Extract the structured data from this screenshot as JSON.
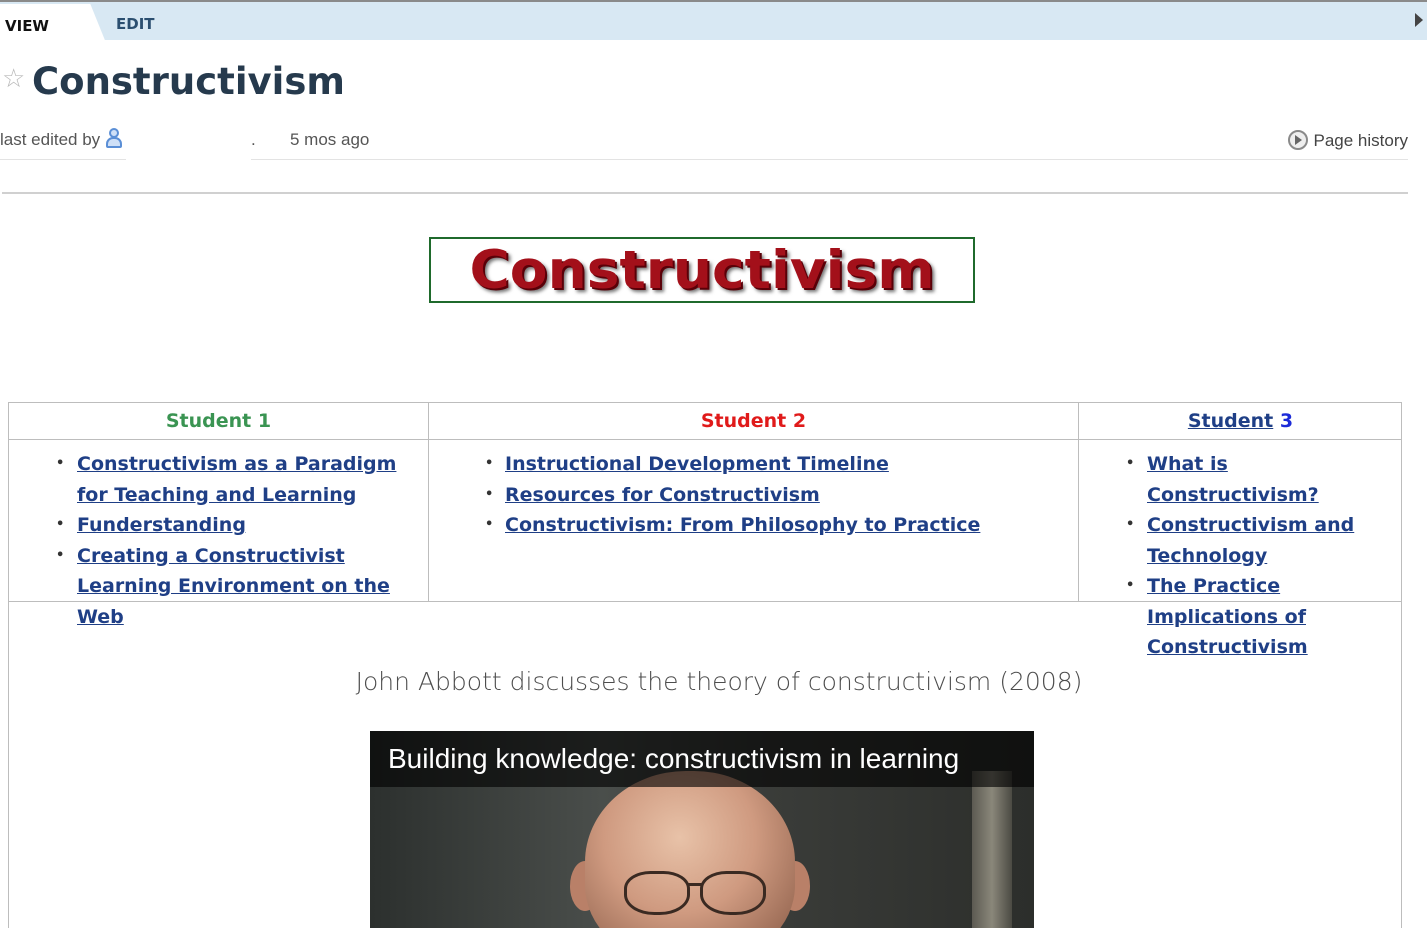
{
  "tabs": {
    "view_label": "VIEW",
    "edit_label": "EDIT"
  },
  "page": {
    "title": "Constructivism",
    "last_edited_label": "last edited by",
    "editor_separator": ".",
    "edited_time": "5 mos ago",
    "history_label": "Page history"
  },
  "banner": {
    "text": "Constructivism"
  },
  "students": [
    {
      "heading": "Student 1",
      "links": [
        "Constructivism as a Paradigm for Teaching and Learning",
        "Funderstanding",
        "Creating a Constructivist Learning Environment on the Web "
      ]
    },
    {
      "heading": "Student 2",
      "links": [
        "Instructional Development Timeline",
        "Resources for Constructivism",
        "Constructivism: From Philosophy to Practice"
      ]
    },
    {
      "heading_word": "Student",
      "heading_num": "3",
      "links": [
        "What is Constructivism?",
        "Constructivism and Technology",
        "The Practice Implications of Constructivism"
      ]
    }
  ],
  "video_section": {
    "caption": "John Abbott discusses the theory of constructivism (2008)",
    "video_title": "Building knowledge: constructivism in learning"
  },
  "colors": {
    "student1": "#3a9452",
    "student2": "#e01a1a",
    "link": "#1f3f86",
    "banner_text": "#a3101a",
    "banner_border": "#1f6a2c",
    "tabbar": "#d8e8f3"
  },
  "icons": [
    "star-icon",
    "user-icon",
    "history-clock-icon",
    "scroll-right-arrow-icon"
  ]
}
